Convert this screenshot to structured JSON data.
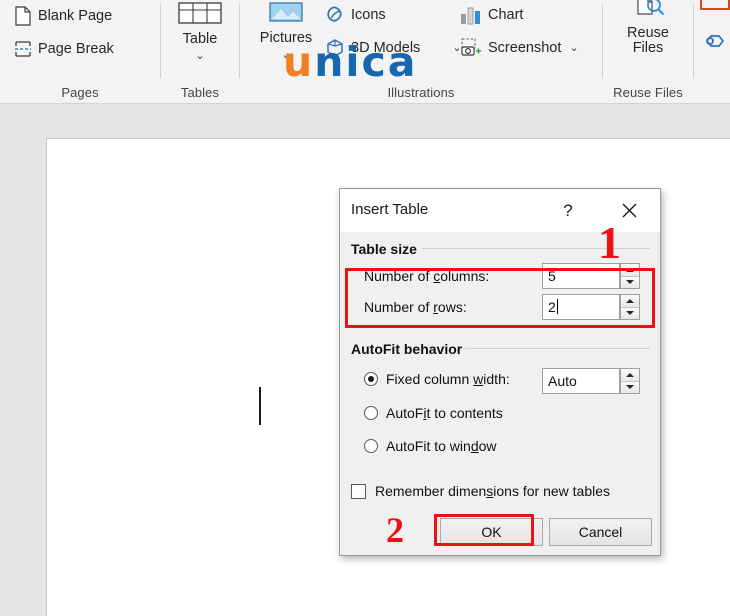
{
  "ribbon": {
    "groups": [
      {
        "name": "Pages",
        "label": "Pages",
        "items": [
          {
            "label": "Blank Page",
            "icon": "blank-page-icon"
          },
          {
            "label": "Page Break",
            "icon": "page-break-icon"
          }
        ]
      },
      {
        "name": "Tables",
        "label": "Tables",
        "items": [
          {
            "label": "Table",
            "icon": "table-grid-icon",
            "dropdown": "⌄"
          }
        ]
      },
      {
        "name": "Illustrations",
        "label": "Illustrations",
        "items": [
          {
            "label": "Pictures",
            "icon": "pictures-icon",
            "dropdown": "⌄"
          },
          {
            "label": "Icons",
            "icon": "icons-icon"
          },
          {
            "label": "3D Models",
            "icon": "3d-models-icon",
            "dropdown": "⌄"
          },
          {
            "label": "Chart",
            "icon": "chart-icon"
          },
          {
            "label": "Screenshot",
            "icon": "screenshot-icon",
            "dropdown": "⌄"
          }
        ]
      },
      {
        "name": "Reuse Files",
        "label": "Reuse Files",
        "items": [
          {
            "label": "Reuse\nFiles",
            "line1": "Reuse",
            "line2": "Files",
            "icon": "reuse-files-icon"
          }
        ]
      }
    ]
  },
  "watermark": {
    "part1": "u",
    "part2": "nica",
    "color_orange": "#f08022",
    "color_blue": "#1667b0"
  },
  "dialog": {
    "title": "Insert Table",
    "help_glyph": "?",
    "close_glyph": "✕",
    "table_size": {
      "heading": "Table size",
      "columns": {
        "label_pre": "Number of ",
        "label_key": "c",
        "label_post": "olumns:",
        "full_label": "Number of columns:",
        "value": "5"
      },
      "rows": {
        "label_pre": "Number of ",
        "label_key": "r",
        "label_post": "ows:",
        "full_label": "Number of rows:",
        "value": "2"
      }
    },
    "autofit": {
      "heading": "AutoFit behavior",
      "options": [
        {
          "label_pre": "Fixed column ",
          "label_key": "w",
          "label_post": "idth:",
          "full_label": "Fixed column width:",
          "selected": true,
          "value": "Auto"
        },
        {
          "label_pre": "AutoF",
          "label_key": "i",
          "label_post": "t to contents",
          "full_label": "AutoFit to contents",
          "selected": false
        },
        {
          "label_pre": "AutoFit to win",
          "label_key": "d",
          "label_post": "ow",
          "full_label": "AutoFit to window",
          "selected": false
        }
      ]
    },
    "remember": {
      "label_pre": "Remember dimen",
      "label_key": "s",
      "label_post": "ions for new tables",
      "full_label": "Remember dimensions for new tables",
      "checked": false
    },
    "buttons": {
      "ok": "OK",
      "cancel": "Cancel"
    }
  },
  "annotations": {
    "step1": "1",
    "step2": "2",
    "color": "#ee1111"
  }
}
